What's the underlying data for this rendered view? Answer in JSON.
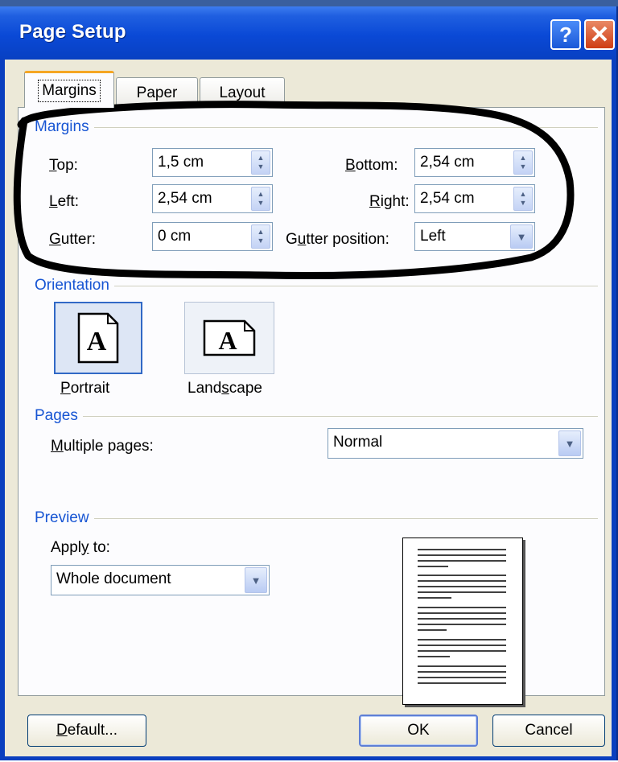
{
  "window": {
    "title": "Page Setup",
    "help_label": "?",
    "close_label": "✕"
  },
  "tabs": [
    {
      "label": "Margins"
    },
    {
      "label": "Paper"
    },
    {
      "label": "Layout"
    }
  ],
  "margins": {
    "group_label": "Margins",
    "top": {
      "label_u": "T",
      "label_rest": "op:",
      "value": "1,5 cm"
    },
    "left": {
      "label_u": "L",
      "label_rest": "eft:",
      "value": "2,54 cm"
    },
    "gutter": {
      "label_u": "G",
      "label_rest": "utter:",
      "value": "0 cm"
    },
    "bottom": {
      "label_u": "B",
      "label_rest": "ottom:",
      "value": "2,54 cm"
    },
    "right": {
      "label_pre": "",
      "label_u": "R",
      "label_rest": "ight:",
      "value": "2,54 cm"
    },
    "gutter_position": {
      "label_pre": "G",
      "label_u": "u",
      "label_rest": "tter position:",
      "value": "Left"
    }
  },
  "orientation": {
    "group_label": "Orientation",
    "portrait": {
      "label_u": "P",
      "label_rest": "ortrait",
      "glyph": "A"
    },
    "landscape": {
      "label_pre": "Land",
      "label_u": "s",
      "label_rest": "cape",
      "glyph": "A"
    }
  },
  "pages": {
    "group_label": "Pages",
    "multiple_label_u": "M",
    "multiple_label_rest": "ultiple pages:",
    "multiple_value": "Normal"
  },
  "preview": {
    "group_label": "Preview",
    "apply_label_pre": "Appl",
    "apply_label_u": "y",
    "apply_label_rest": " to:",
    "apply_value": "Whole document"
  },
  "buttons": {
    "default_u": "D",
    "default_rest": "efault...",
    "ok": "OK",
    "cancel": "Cancel"
  },
  "icons": {
    "spin_up": "▲",
    "spin_down": "▼",
    "dropdown": "▼"
  },
  "colors": {
    "title_bar": "#0a49d6",
    "group_label": "#1755d3",
    "dialog_bg": "#ece9d8",
    "marker": "#000000"
  }
}
